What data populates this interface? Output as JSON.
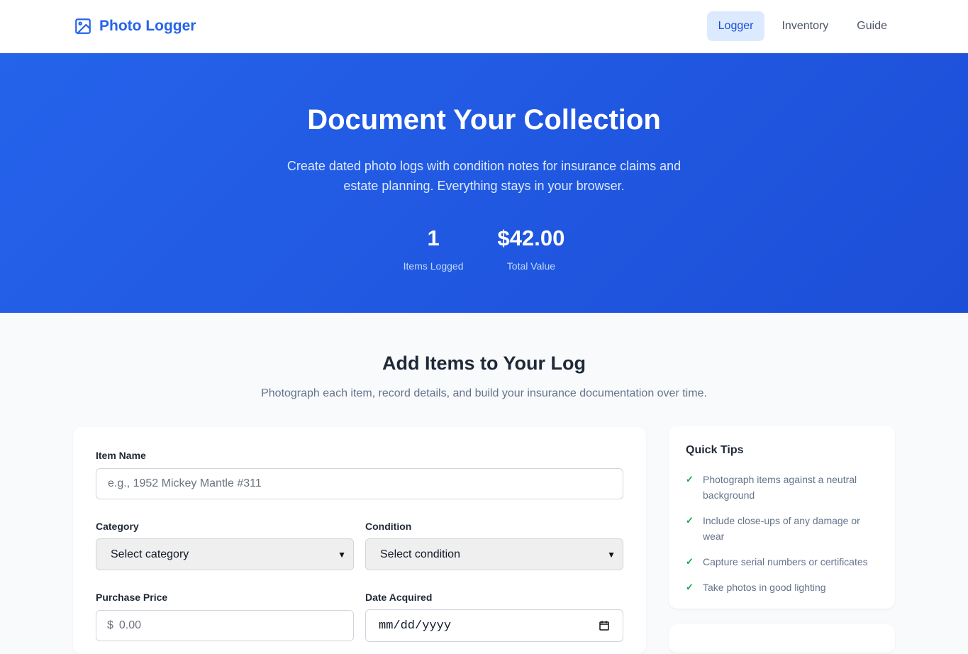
{
  "brand": {
    "name": "Photo Logger",
    "icon": "image-icon",
    "color": "#2563eb"
  },
  "nav": [
    {
      "label": "Logger",
      "active": true
    },
    {
      "label": "Inventory",
      "active": false
    },
    {
      "label": "Guide",
      "active": false
    }
  ],
  "hero": {
    "title": "Document Your Collection",
    "subtitle": "Create dated photo logs with condition notes for insurance claims and estate planning. Everything stays in your browser.",
    "stats": [
      {
        "value": "1",
        "label": "Items Logged"
      },
      {
        "value": "$42.00",
        "label": "Total Value"
      }
    ]
  },
  "section": {
    "title": "Add Items to Your Log",
    "subtitle": "Photograph each item, record details, and build your insurance documentation over time."
  },
  "form": {
    "item_name": {
      "label": "Item Name",
      "placeholder": "e.g., 1952 Mickey Mantle #311"
    },
    "category": {
      "label": "Category",
      "value": "Select category"
    },
    "condition": {
      "label": "Condition",
      "value": "Select condition"
    },
    "price": {
      "label": "Purchase Price",
      "prefix": "$",
      "placeholder": "0.00"
    },
    "date": {
      "label": "Date Acquired",
      "placeholder": "mm/dd/yyyy"
    }
  },
  "tips": {
    "title": "Quick Tips",
    "items": [
      "Photograph items against a neutral background",
      "Include close-ups of any damage or wear",
      "Capture serial numbers or certificates",
      "Take photos in good lighting"
    ]
  },
  "colors": {
    "hero_start": "#2563eb",
    "hero_end": "#1d4ed8",
    "check": "#16a34a",
    "nav_active_bg": "#dbeafe"
  }
}
